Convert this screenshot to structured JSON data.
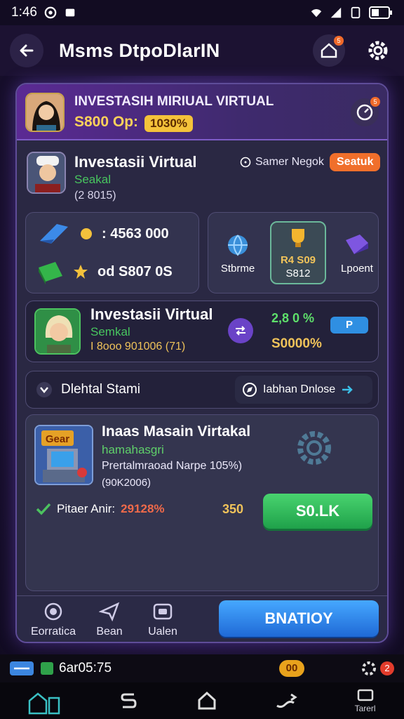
{
  "status_bar": {
    "time": "1:46",
    "signal": "wifi-signal-battery"
  },
  "app_bar": {
    "title": "Msms DtpoDlarIN",
    "back_icon": "arrow-left-icon",
    "notif_badge": "5"
  },
  "hero": {
    "title": "INVESTASIH MIRIUAL VIRTUAL",
    "amount": "S800 Op:",
    "chip": "1030%",
    "timer_badge": "5"
  },
  "profile": {
    "title": "Investasii Virtual",
    "subtitle": "Seakal",
    "number": "(2 8015)",
    "link": "Samer Negok",
    "button": "Seatuk"
  },
  "stats": {
    "row1": ": 4563 000",
    "row2": "od S807 0S"
  },
  "tiles": [
    {
      "label": "Stbrme"
    },
    {
      "label": "R4 S09",
      "sub": "S812"
    },
    {
      "label": "Lpoent"
    }
  ],
  "featured": {
    "title": "Investasii Virtual",
    "subtitle": "Semkal",
    "number": "I 8ooo 901006 (71)",
    "pct": "2,8 0 %",
    "value": "S0000%",
    "chip": "P"
  },
  "bar": {
    "left_label": "Dlehtal Stami",
    "right_label": "Iabhan Dnlose"
  },
  "investment": {
    "title": "Inaas Masain Virtakal",
    "subtitle": "hamahasgri",
    "description": "Prertalmraoad Narpe 105%)",
    "number": "(90K2006)",
    "status_label": "Pitaer Anir:",
    "status_value": "29128%",
    "quantity": "350",
    "button": "S0.LK",
    "image_label": "Gear"
  },
  "tabbar": {
    "tabs": [
      {
        "label": "Eorratica"
      },
      {
        "label": "Bean"
      },
      {
        "label": "Ualen"
      }
    ],
    "cta": "BNATIOY"
  },
  "bottom_strip": {
    "time": "6ar05:75",
    "badge_left": "00",
    "badge_right": "2"
  },
  "nav": {
    "last_label": "Tarerl"
  },
  "colors": {
    "accent": "#5f4d99",
    "green": "#48c55f",
    "orange": "#f06f2b",
    "gold": "#f0c35a",
    "blue": "#2f8fe2"
  }
}
